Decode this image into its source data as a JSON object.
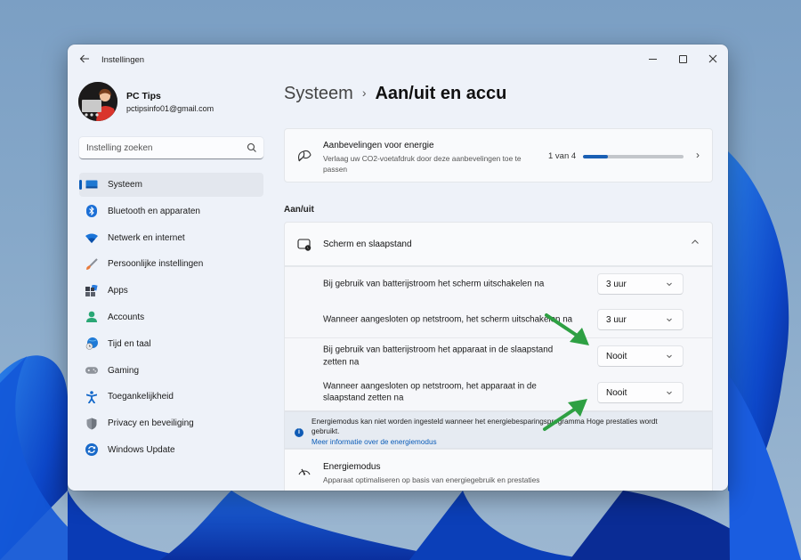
{
  "window": {
    "title": "Instellingen",
    "controls": {
      "minimize": "minimize",
      "maximize": "maximize",
      "close": "close"
    }
  },
  "profile": {
    "name": "PC Tips",
    "email": "pctipsinfo01@gmail.com"
  },
  "search": {
    "placeholder": "Instelling zoeken",
    "icon": "search-icon"
  },
  "sidebar": {
    "items": [
      {
        "label": "Systeem",
        "icon": "system-icon",
        "active": true
      },
      {
        "label": "Bluetooth en apparaten",
        "icon": "bluetooth-icon"
      },
      {
        "label": "Netwerk en internet",
        "icon": "wifi-icon"
      },
      {
        "label": "Persoonlijke instellingen",
        "icon": "brush-icon"
      },
      {
        "label": "Apps",
        "icon": "apps-icon"
      },
      {
        "label": "Accounts",
        "icon": "person-icon"
      },
      {
        "label": "Tijd en taal",
        "icon": "globe-clock-icon"
      },
      {
        "label": "Gaming",
        "icon": "gamepad-icon"
      },
      {
        "label": "Toegankelijkheid",
        "icon": "accessibility-icon"
      },
      {
        "label": "Privacy en beveiliging",
        "icon": "shield-icon"
      },
      {
        "label": "Windows Update",
        "icon": "update-icon"
      }
    ]
  },
  "breadcrumb": {
    "parent": "Systeem",
    "separator": "›",
    "current": "Aan/uit en accu"
  },
  "recommendations": {
    "title": "Aanbevelingen voor energie",
    "description": "Verlaag uw CO2-voetafdruk door deze aanbevelingen toe te passen",
    "count": "1 van 4",
    "progress_fraction": 0.25,
    "chevron": "›"
  },
  "power_section": {
    "title": "Aan/uit",
    "screen_sleep": {
      "title": "Scherm en slaapstand",
      "expanded": true,
      "rows": [
        {
          "label": "Bij gebruik van batterijstroom het scherm uitschakelen na",
          "value": "3 uur"
        },
        {
          "label": "Wanneer aangesloten op netstroom, het scherm uitschakelen na",
          "value": "3 uur"
        },
        {
          "label": "Bij gebruik van batterijstroom het apparaat in de slaapstand zetten na",
          "value": "Nooit"
        },
        {
          "label": "Wanneer aangesloten op netstroom, het apparaat in de slaapstand zetten na",
          "value": "Nooit"
        }
      ]
    },
    "info": {
      "text": "Energiemodus kan niet worden ingesteld wanneer het energiebesparingsprogramma Hoge prestaties wordt gebruikt.",
      "link": "Meer informatie over de energiemodus"
    },
    "energy_mode": {
      "title": "Energiemodus",
      "description": "Apparaat optimaliseren op basis van energiegebruik en prestaties"
    }
  },
  "colors": {
    "accent": "#0b5cb8",
    "annotation_arrow": "#2ea043"
  }
}
